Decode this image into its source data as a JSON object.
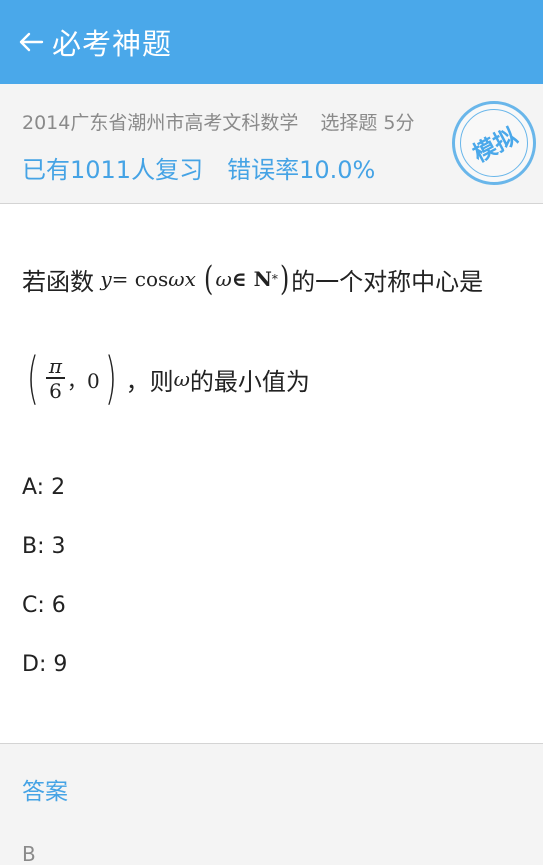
{
  "header": {
    "title": "必考神题"
  },
  "info": {
    "source": "2014广东省潮州市高考文科数学",
    "type": "选择题",
    "score": "5分",
    "reviewed": "已有1011人复习",
    "error_rate": "错误率10.0%",
    "stamp": "模拟"
  },
  "question": {
    "part1": "若函数",
    "formula_y": "y",
    "formula_eq": " = cos ",
    "formula_omega": "ω",
    "formula_x": "x",
    "cond_omega": "ω",
    "cond_in": " ∈ N",
    "cond_sup": "*",
    "part2": "的一个对称中心是",
    "frac_num": "π",
    "frac_den": "6",
    "point_sep": "，0",
    "part3": "，则",
    "omega2": "ω",
    "part4": "的最小值为"
  },
  "options": [
    {
      "text": "A: 2"
    },
    {
      "text": "B: 3"
    },
    {
      "text": "C: 6"
    },
    {
      "text": "D: 9"
    }
  ],
  "answer": {
    "label": "答案",
    "value": "B"
  },
  "colors": {
    "primary": "#4aa8ea",
    "accent_text": "#45a3e5"
  },
  "icons": {
    "back": "arrow-left-icon"
  }
}
